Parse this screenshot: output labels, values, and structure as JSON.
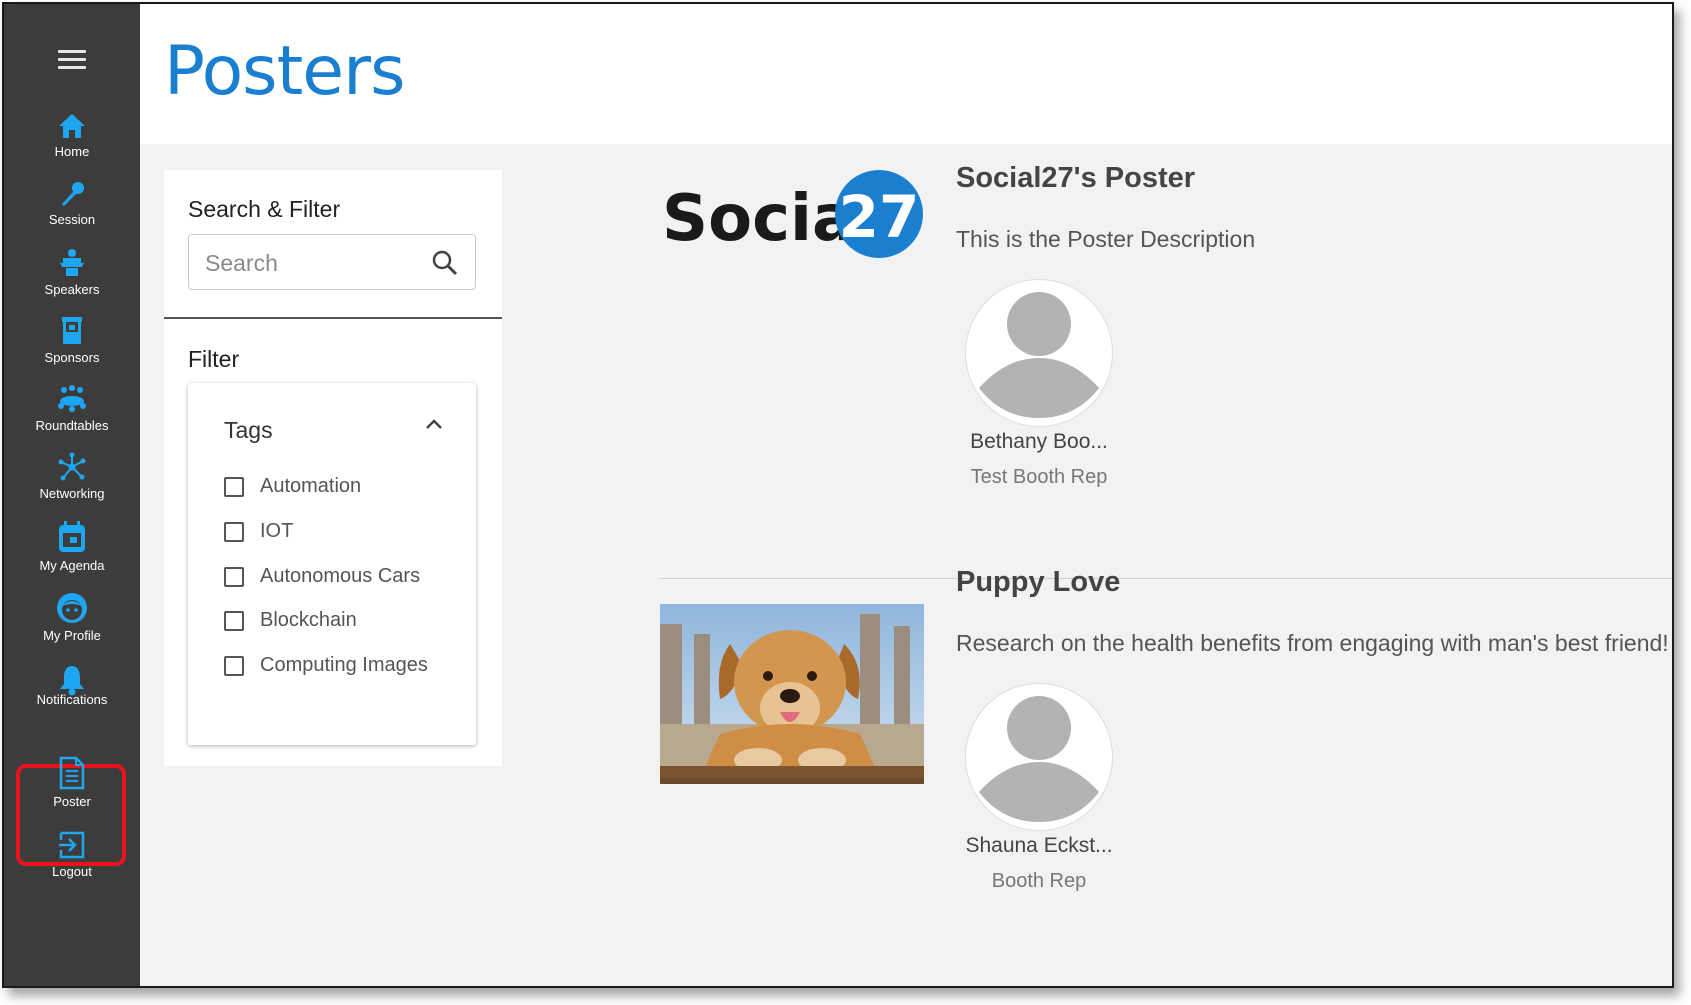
{
  "page": {
    "title": "Posters"
  },
  "sidebar": {
    "menu_icon": "hamburger-menu-icon",
    "items": [
      {
        "label": "Home",
        "icon": "home-icon"
      },
      {
        "label": "Session",
        "icon": "microphone-icon"
      },
      {
        "label": "Speakers",
        "icon": "podium-icon"
      },
      {
        "label": "Sponsors",
        "icon": "booth-icon"
      },
      {
        "label": "Roundtables",
        "icon": "group-icon"
      },
      {
        "label": "Networking",
        "icon": "network-icon"
      },
      {
        "label": "My Agenda",
        "icon": "calendar-icon"
      },
      {
        "label": "My Profile",
        "icon": "profile-face-icon"
      },
      {
        "label": "Notifications",
        "icon": "bell-icon"
      },
      {
        "label": "Poster",
        "icon": "document-icon",
        "active": true
      },
      {
        "label": "Logout",
        "icon": "logout-icon"
      }
    ],
    "icon_color": "#1ea7f0",
    "highlight_color": "#e8141c"
  },
  "filter": {
    "title": "Search & Filter",
    "search_placeholder": "Search",
    "filter_label": "Filter",
    "tags_title": "Tags",
    "tags": [
      "Automation",
      "IOT",
      "Autonomous Cars",
      "Blockchain",
      "Computing Images"
    ]
  },
  "posters": [
    {
      "logo_text": "Social",
      "logo_number": "27",
      "title": "Social27's Poster",
      "description": "This is the Poster Description",
      "rep_name": "Bethany Boo...",
      "rep_role": "Test Booth Rep"
    },
    {
      "title": "Puppy Love",
      "description": "Research on the health benefits from engaging with man's best friend!",
      "rep_name": "Shauna Eckst...",
      "rep_role": "Booth Rep"
    }
  ],
  "colors": {
    "title_blue": "#1b7fd0",
    "sidebar_bg": "#3c3c3c",
    "content_bg": "#f2f2f2"
  }
}
